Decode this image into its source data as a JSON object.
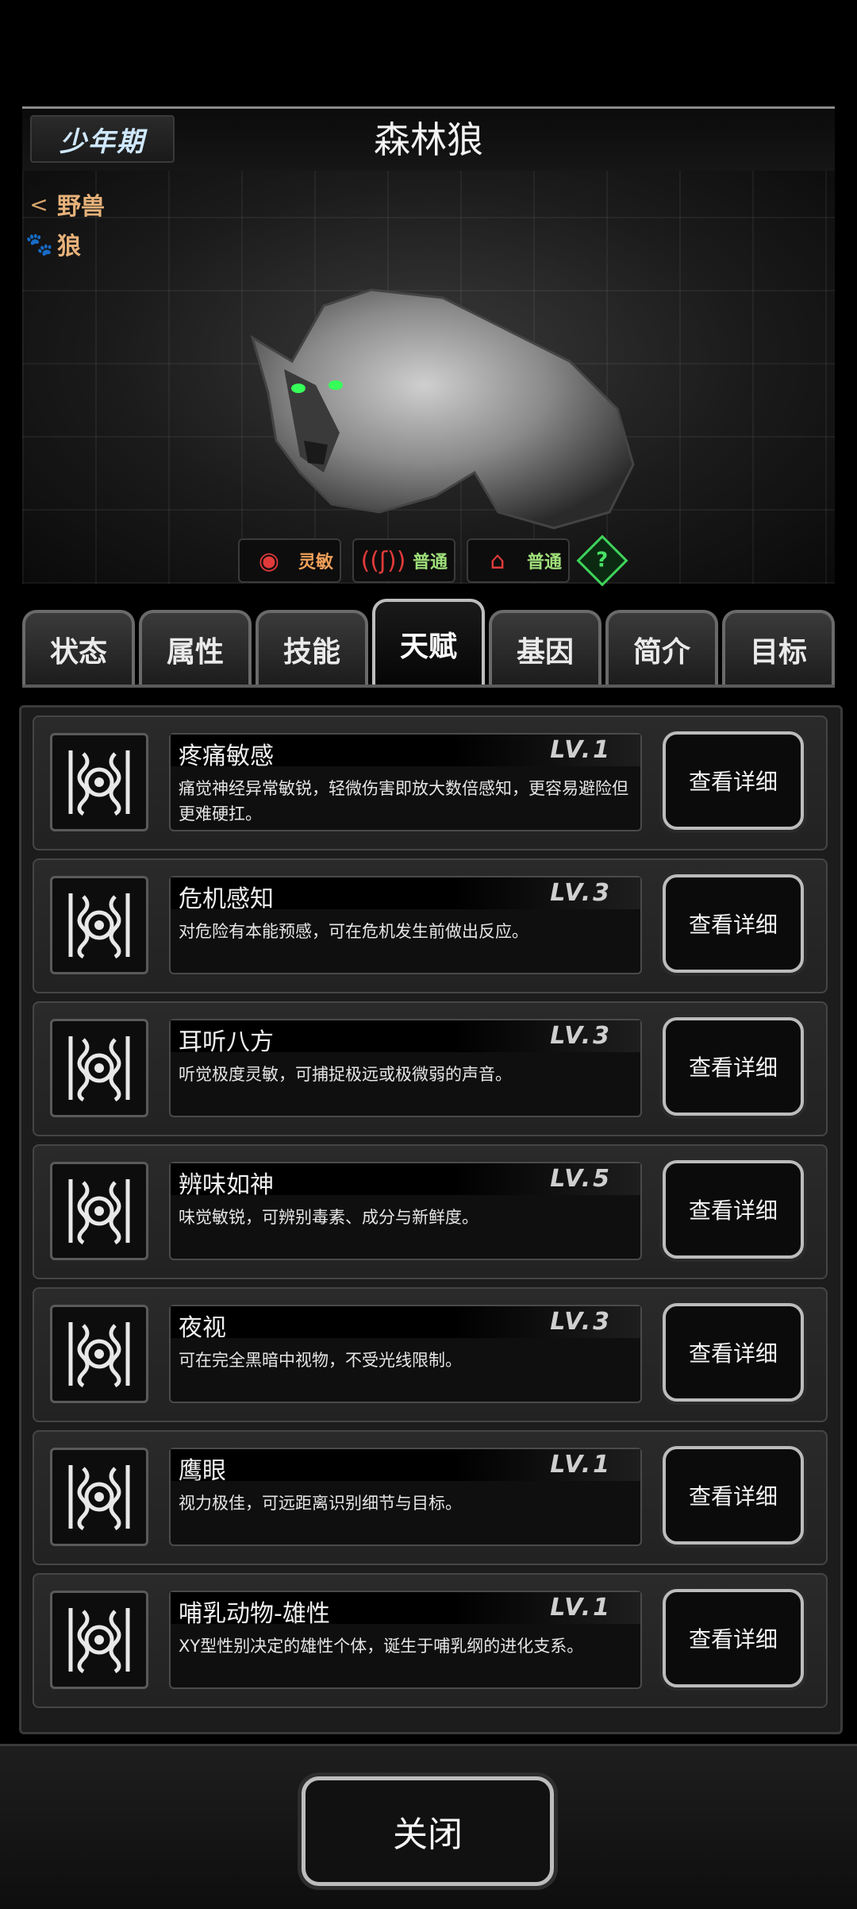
{
  "header": {
    "stage": "少年期",
    "title": "森林狼"
  },
  "creature": {
    "tags": [
      {
        "icon": "share-icon",
        "label": "野兽"
      },
      {
        "icon": "paw-icon",
        "label": "狼"
      }
    ],
    "senses": [
      {
        "icon": "eye-icon",
        "label": "灵敏",
        "color": "#f0a05a"
      },
      {
        "icon": "ear-icon",
        "label": "普通",
        "color": "#9fe07a"
      },
      {
        "icon": "nose-icon",
        "label": "普通",
        "color": "#9fe07a"
      }
    ],
    "help": "?"
  },
  "tabs": [
    {
      "label": "状态",
      "active": false
    },
    {
      "label": "属性",
      "active": false
    },
    {
      "label": "技能",
      "active": false
    },
    {
      "label": "天赋",
      "active": true
    },
    {
      "label": "基因",
      "active": false
    },
    {
      "label": "简介",
      "active": false
    },
    {
      "label": "目标",
      "active": false
    }
  ],
  "talents": [
    {
      "name": "疼痛敏感",
      "level": "LV.1",
      "desc": "痛觉神经异常敏锐，轻微伤害即放大数倍感知，更容易避险但更难硬扛。",
      "button": "查看详细"
    },
    {
      "name": "危机感知",
      "level": "LV.3",
      "desc": "对危险有本能预感，可在危机发生前做出反应。",
      "button": "查看详细"
    },
    {
      "name": "耳听八方",
      "level": "LV.3",
      "desc": "听觉极度灵敏，可捕捉极远或极微弱的声音。",
      "button": "查看详细"
    },
    {
      "name": "辨味如神",
      "level": "LV.5",
      "desc": "味觉敏锐，可辨别毒素、成分与新鲜度。",
      "button": "查看详细"
    },
    {
      "name": "夜视",
      "level": "LV.3",
      "desc": "可在完全黑暗中视物，不受光线限制。",
      "button": "查看详细"
    },
    {
      "name": "鹰眼",
      "level": "LV.1",
      "desc": "视力极佳，可远距离识别细节与目标。",
      "button": "查看详细"
    },
    {
      "name": "哺乳动物-雄性",
      "level": "LV.1",
      "desc": "XY型性别决定的雄性个体，诞生于哺乳纲的进化支系。",
      "button": "查看详细"
    }
  ],
  "footer": {
    "close": "关闭"
  }
}
